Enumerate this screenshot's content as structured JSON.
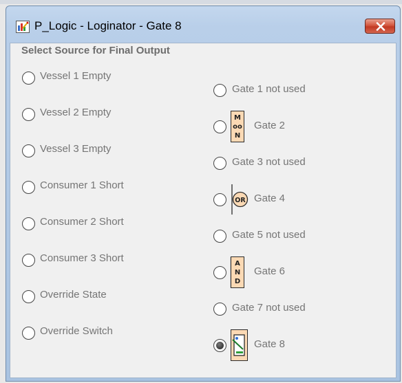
{
  "window": {
    "title": "P_Logic - Loginator - Gate 8"
  },
  "heading": "Select Source for Final Output",
  "sources": [
    {
      "label": "Vessel 1 Empty",
      "selected": false
    },
    {
      "label": "Vessel 2 Empty",
      "selected": false
    },
    {
      "label": "Vessel 3 Empty",
      "selected": false
    },
    {
      "label": "Consumer 1 Short",
      "selected": false
    },
    {
      "label": "Consumer 2 Short",
      "selected": false
    },
    {
      "label": "Consumer 3 Short",
      "selected": false
    },
    {
      "label": "Override State",
      "selected": false
    },
    {
      "label": "Override Switch",
      "selected": false
    }
  ],
  "gates": [
    {
      "label": "Gate 1 not used",
      "icon": "none",
      "selected": false
    },
    {
      "label": "Gate 2",
      "icon": "moon-gate-icon",
      "icon_text": [
        "M",
        "oo",
        "N"
      ],
      "selected": false
    },
    {
      "label": "Gate 3 not used",
      "icon": "none",
      "selected": false
    },
    {
      "label": "Gate 4",
      "icon": "or-gate-icon",
      "icon_text": "OR",
      "selected": false
    },
    {
      "label": "Gate 5 not used",
      "icon": "none",
      "selected": false
    },
    {
      "label": "Gate 6",
      "icon": "and-gate-icon",
      "icon_text": [
        "A",
        "N",
        "D"
      ],
      "selected": false
    },
    {
      "label": "Gate 7 not used",
      "icon": "none",
      "selected": false
    },
    {
      "label": "Gate 8",
      "icon": "switch-gate-icon",
      "selected": true
    }
  ],
  "colors": {
    "gate_icon_fill": "#fbd9b4",
    "label_text": "#757575",
    "close_button": "#c8412b"
  }
}
